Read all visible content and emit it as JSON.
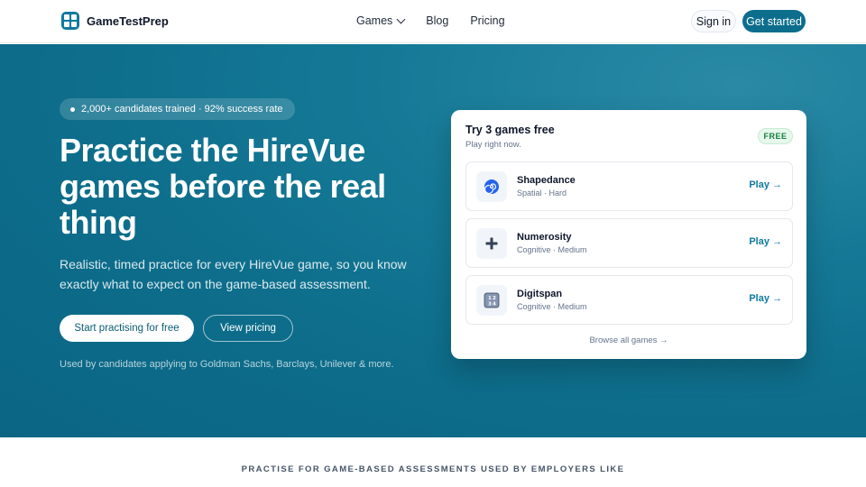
{
  "header": {
    "brand": "GameTestPrep",
    "nav": [
      {
        "label": "Games",
        "dropdown": true
      },
      {
        "label": "Blog"
      },
      {
        "label": "Pricing"
      }
    ],
    "sign_in": "Sign in",
    "get_started": "Get started"
  },
  "hero": {
    "badge": "2,000+ candidates trained · 92% success rate",
    "title": "Practice the HireVue games before the real thing",
    "subtitle": "Realistic, timed practice for every HireVue game, so you know exactly what to expect on the game-based assessment.",
    "cta_primary": "Start practising for free",
    "cta_secondary": "View pricing",
    "note": "Used by candidates applying to Goldman Sachs, Barclays, Unilever & more."
  },
  "free_card": {
    "title": "Try 3 games free",
    "subtitle": "Play right now.",
    "badge": "FREE",
    "games": [
      {
        "name": "Shapedance",
        "meta": "Spatial · Hard",
        "icon": "spiral-icon",
        "action": "Play →"
      },
      {
        "name": "Numerosity",
        "meta": "Cognitive · Medium",
        "icon": "plus-icon",
        "action": "Play →"
      },
      {
        "name": "Digitspan",
        "meta": "Cognitive · Medium",
        "icon": "number-keypad-icon",
        "action": "Play →"
      }
    ],
    "browse": "Browse all games →"
  },
  "employers_section": {
    "title": "PRACTISE FOR GAME-BASED ASSESSMENTS USED BY EMPLOYERS LIKE"
  },
  "colors": {
    "accent": "#0c6e8c",
    "hero_bg": "#0d6d8b",
    "free_badge": "#15803d"
  }
}
